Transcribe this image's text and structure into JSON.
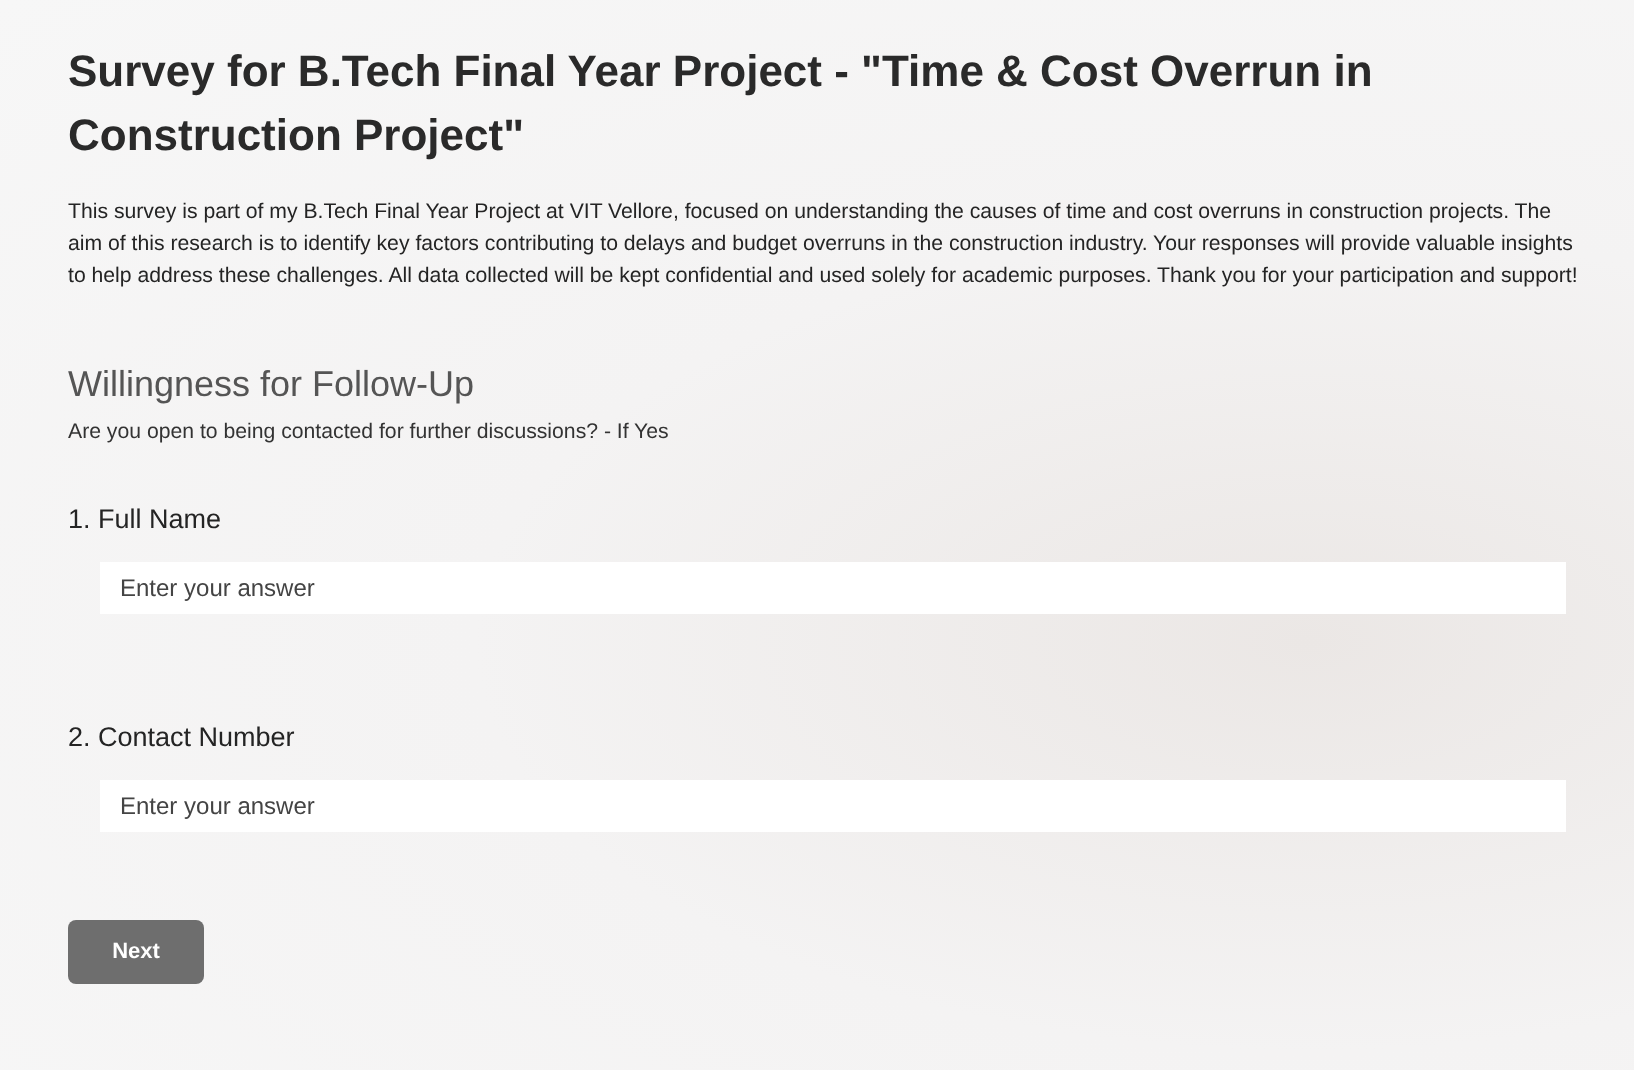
{
  "title": "Survey for B.Tech Final Year Project - \"Time & Cost Overrun in Construction Project\"",
  "description": "This survey is part of my B.Tech Final Year Project at VIT Vellore, focused on understanding the causes of time and cost overruns in construction projects. The aim of this research is to identify key factors contributing to delays and budget overruns in the construction industry. Your responses will provide valuable insights to help address these challenges. All data collected will be kept confidential and used solely for academic purposes. Thank you for your participation and support!",
  "section": {
    "title": "Willingness for Follow-Up",
    "subtitle": "Are you open to being contacted for further discussions? - If Yes"
  },
  "questions": [
    {
      "label": "1. Full Name",
      "placeholder": "Enter your answer"
    },
    {
      "label": "2. Contact Number",
      "placeholder": "Enter your answer"
    }
  ],
  "buttons": [
    "Next"
  ]
}
